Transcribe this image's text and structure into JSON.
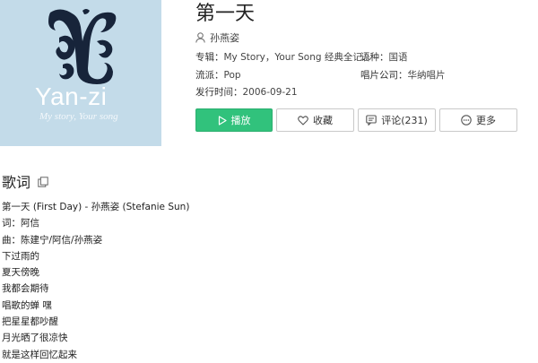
{
  "cover": {
    "brand": "Yan-zi",
    "tagline": "My story, Your song"
  },
  "song": {
    "title": "第一天",
    "artist": "孙燕姿",
    "meta": {
      "album_label": "专辑：",
      "album_value": "My Story，Your Song 经典全记...",
      "language_label": "语种：",
      "language_value": "国语",
      "genre_label": "流派：",
      "genre_value": "Pop",
      "label_label": "唱片公司：",
      "label_value": "华纳唱片",
      "release_label": "发行时间：",
      "release_value": "2006-09-21"
    }
  },
  "actions": {
    "play": "播放",
    "favorite": "收藏",
    "comments": "评论(231)",
    "more": "更多"
  },
  "lyrics": {
    "heading": "歌词",
    "lines": [
      "第一天 (First Day) - 孙燕姿 (Stefanie Sun)",
      "词：阿信",
      "曲：陈建宁/阿信/孙燕姿",
      "下过雨的",
      "夏天傍晚",
      "我都会期待",
      "唱歌的蝉 嘿",
      "把星星都吵醒",
      "月光晒了很凉快",
      "就是这样回忆起来"
    ]
  },
  "colors": {
    "accent": "#31c27c",
    "cover_bg": "#c3dbe9",
    "emblem": "#17243a"
  }
}
